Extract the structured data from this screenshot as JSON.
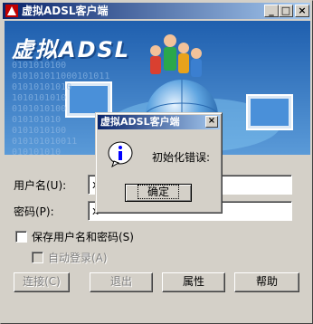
{
  "window": {
    "title": "虚拟ADSL客户端",
    "min_label": "_",
    "max_label": "□",
    "close_label": "×"
  },
  "banner": {
    "logo_text": "虚拟ADSL",
    "binary_rows": [
      "0101010100",
      "010101011000101011",
      "01010101010",
      "1010101010",
      "0101010100",
      "010101010",
      "0101010100",
      "010101010011",
      "010101010"
    ]
  },
  "form": {
    "username_label": "用户名(U):",
    "username_value": "x",
    "password_label": "密码(P):",
    "password_value": "x",
    "save_label": "保存用户名和密码(S)",
    "autologin_label": "自动登录(A)"
  },
  "buttons": {
    "connect": "连接(C)",
    "exit": "退出",
    "properties": "属性",
    "help": "帮助"
  },
  "dialog": {
    "title": "虚拟ADSL客户端",
    "close_label": "×",
    "message": "初始化错误:",
    "ok": "确定",
    "icon": "info-icon"
  }
}
